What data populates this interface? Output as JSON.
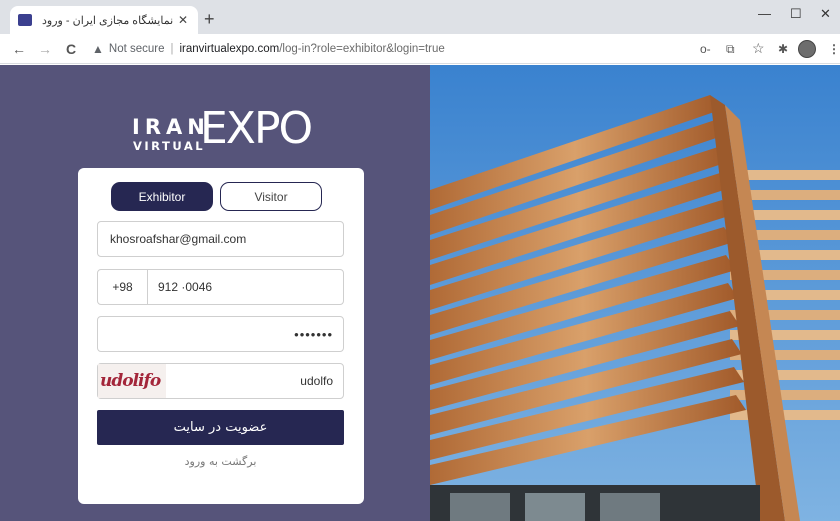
{
  "browser": {
    "tab_title": "نمایشگاه مجازی ایران - ورود",
    "tab_close": "✕",
    "new_tab": "+",
    "minimize": "—",
    "maximize": "☐",
    "close": "✕",
    "back": "←",
    "forward": "→",
    "reload": "C",
    "security_label": "Not secure",
    "url_host": "iranvirtualexpo.com",
    "url_rest": "/log-in?role=exhibitor&login=true",
    "key_icon": "o-",
    "translate_icon": "⧉",
    "star_icon": "☆",
    "puzzle_icon": "✱",
    "menu_icon": "⋮"
  },
  "logo": {
    "word1": "IRAN",
    "word2": "VIRTUAL",
    "word3": "EXPO"
  },
  "form": {
    "tab_exhibitor": "Exhibitor",
    "tab_visitor": "Visitor",
    "email_value": "khosroafshar@gmail.com",
    "phone_code": "+98",
    "phone_number": "912  ·0046",
    "password_mask": "•••••••",
    "captcha_image_text": "udolifo",
    "captcha_value": "udolfo",
    "submit_label": "عضویت در سایت",
    "back_link": "برگشت به ورود"
  },
  "colors": {
    "left_panel": "#56547a",
    "primary": "#262752",
    "sky": "#4a8fd4",
    "wood": "#c8864a"
  }
}
